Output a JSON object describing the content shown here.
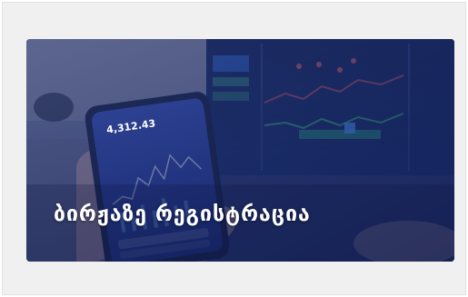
{
  "card": {
    "title": "ბირჟაზე რეგისტრაცია",
    "link": true
  },
  "phone_screen": {
    "price_label": "4,312.43"
  },
  "colors": {
    "frame_background": "#f0f0f0",
    "overlay_tint": "#1f3a9e",
    "title_text": "#ffffff"
  }
}
